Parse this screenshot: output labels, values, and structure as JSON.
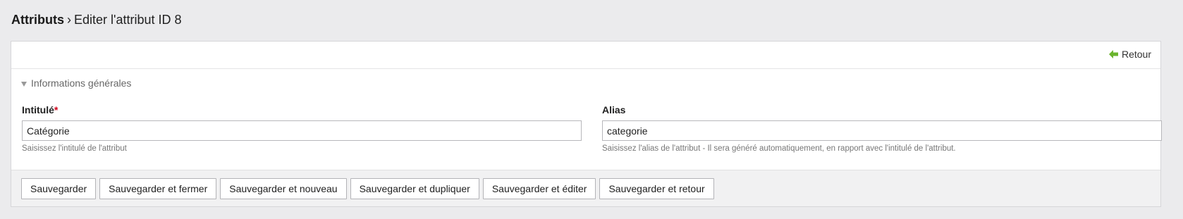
{
  "header": {
    "breadcrumb_root": "Attributs",
    "separator": "›",
    "title": "Editer l'attribut ID 8"
  },
  "toolbar": {
    "back_label": "Retour",
    "back_icon": "arrow-left-icon",
    "back_icon_color": "#6ab42d"
  },
  "section": {
    "label": "Informations générales",
    "toggle_icon": "triangle-down-icon"
  },
  "fields": {
    "title": {
      "label": "Intitulé",
      "required_mark": "*",
      "value": "Catégorie",
      "help": "Saisissez l'intitulé de l'attribut"
    },
    "alias": {
      "label": "Alias",
      "value": "categorie",
      "help": "Saisissez l'alias de l'attribut - Il sera généré automatiquement, en rapport avec l'intitulé de l'attribut."
    }
  },
  "footer": {
    "buttons": [
      "Sauvegarder",
      "Sauvegarder et fermer",
      "Sauvegarder et nouveau",
      "Sauvegarder et dupliquer",
      "Sauvegarder et éditer",
      "Sauvegarder et retour"
    ]
  },
  "colors": {
    "required": "#d0021b",
    "page_background": "#ebebed"
  }
}
